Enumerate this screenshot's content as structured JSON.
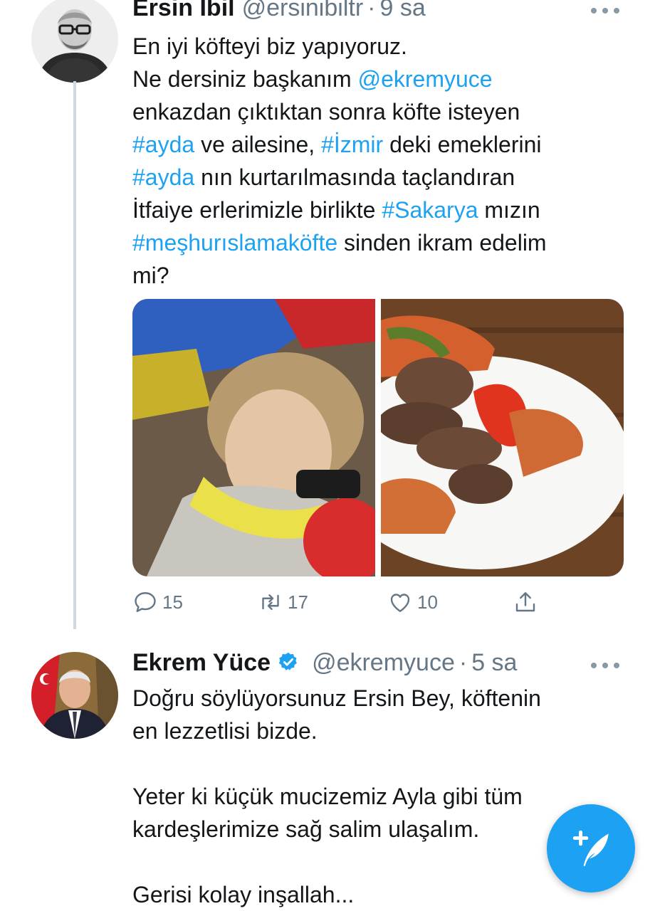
{
  "tweets": [
    {
      "name": "Ersin İbil",
      "handle": "@ersinibiltr",
      "time": "9 sa",
      "body": [
        [
          {
            "t": "En iyi köfteyi biz yapıyoruz.",
            "link": false
          }
        ],
        [
          {
            "t": "Ne dersiniz başkanım ",
            "link": false
          },
          {
            "t": "@ekremyuce",
            "link": true
          }
        ],
        [
          {
            "t": "enkazdan çıktıktan sonra köfte isteyen",
            "link": false
          }
        ],
        [
          {
            "t": "#ayda",
            "link": true
          },
          {
            "t": " ve ailesine, ",
            "link": false
          },
          {
            "t": "#İzmir",
            "link": true
          },
          {
            "t": " deki emeklerini",
            "link": false
          }
        ],
        [
          {
            "t": "#ayda",
            "link": true
          },
          {
            "t": " nın  kurtarılmasında taçlandıran",
            "link": false
          }
        ],
        [
          {
            "t": "İtfaiye erlerimizle birlikte ",
            "link": false
          },
          {
            "t": "#Sakarya",
            "link": true
          },
          {
            "t": " mızın",
            "link": false
          }
        ],
        [
          {
            "t": "#meşhurıslamaköfte",
            "link": true
          },
          {
            "t": " sinden ikram edelim",
            "link": false
          }
        ],
        [
          {
            "t": "mi?",
            "link": false
          }
        ]
      ],
      "media": [
        "rescued-child-photo",
        "meatballs-plate-photo"
      ],
      "stats": {
        "replies": "15",
        "retweets": "17",
        "likes": "10"
      }
    },
    {
      "name": "Ekrem Yüce",
      "verified": true,
      "handle": "@ekremyuce",
      "time": "5 sa",
      "body": [
        [
          {
            "t": "Doğru söylüyorsunuz Ersin Bey, köftenin",
            "link": false
          }
        ],
        [
          {
            "t": "en lezzetlisi bizde.",
            "link": false
          }
        ],
        [],
        [
          {
            "t": "Yeter ki küçük mucizemiz Ayla gibi tüm",
            "link": false
          }
        ],
        [
          {
            "t": "kardeşlerimize sağ salim ulaşalım.",
            "link": false
          }
        ],
        [],
        [
          {
            "t": "Gerisi kolay inşallah...",
            "link": false
          }
        ]
      ]
    }
  ],
  "separator": "·",
  "icons": {
    "reply": "reply-icon",
    "retweet": "retweet-icon",
    "like": "heart-icon",
    "share": "share-icon",
    "more": "more-icon",
    "verified": "verified-badge-icon",
    "compose": "compose-tweet-icon"
  },
  "colors": {
    "accent": "#1da1f2",
    "text": "#14171a",
    "secondary": "#657786",
    "thread_line": "#cfd9de"
  }
}
